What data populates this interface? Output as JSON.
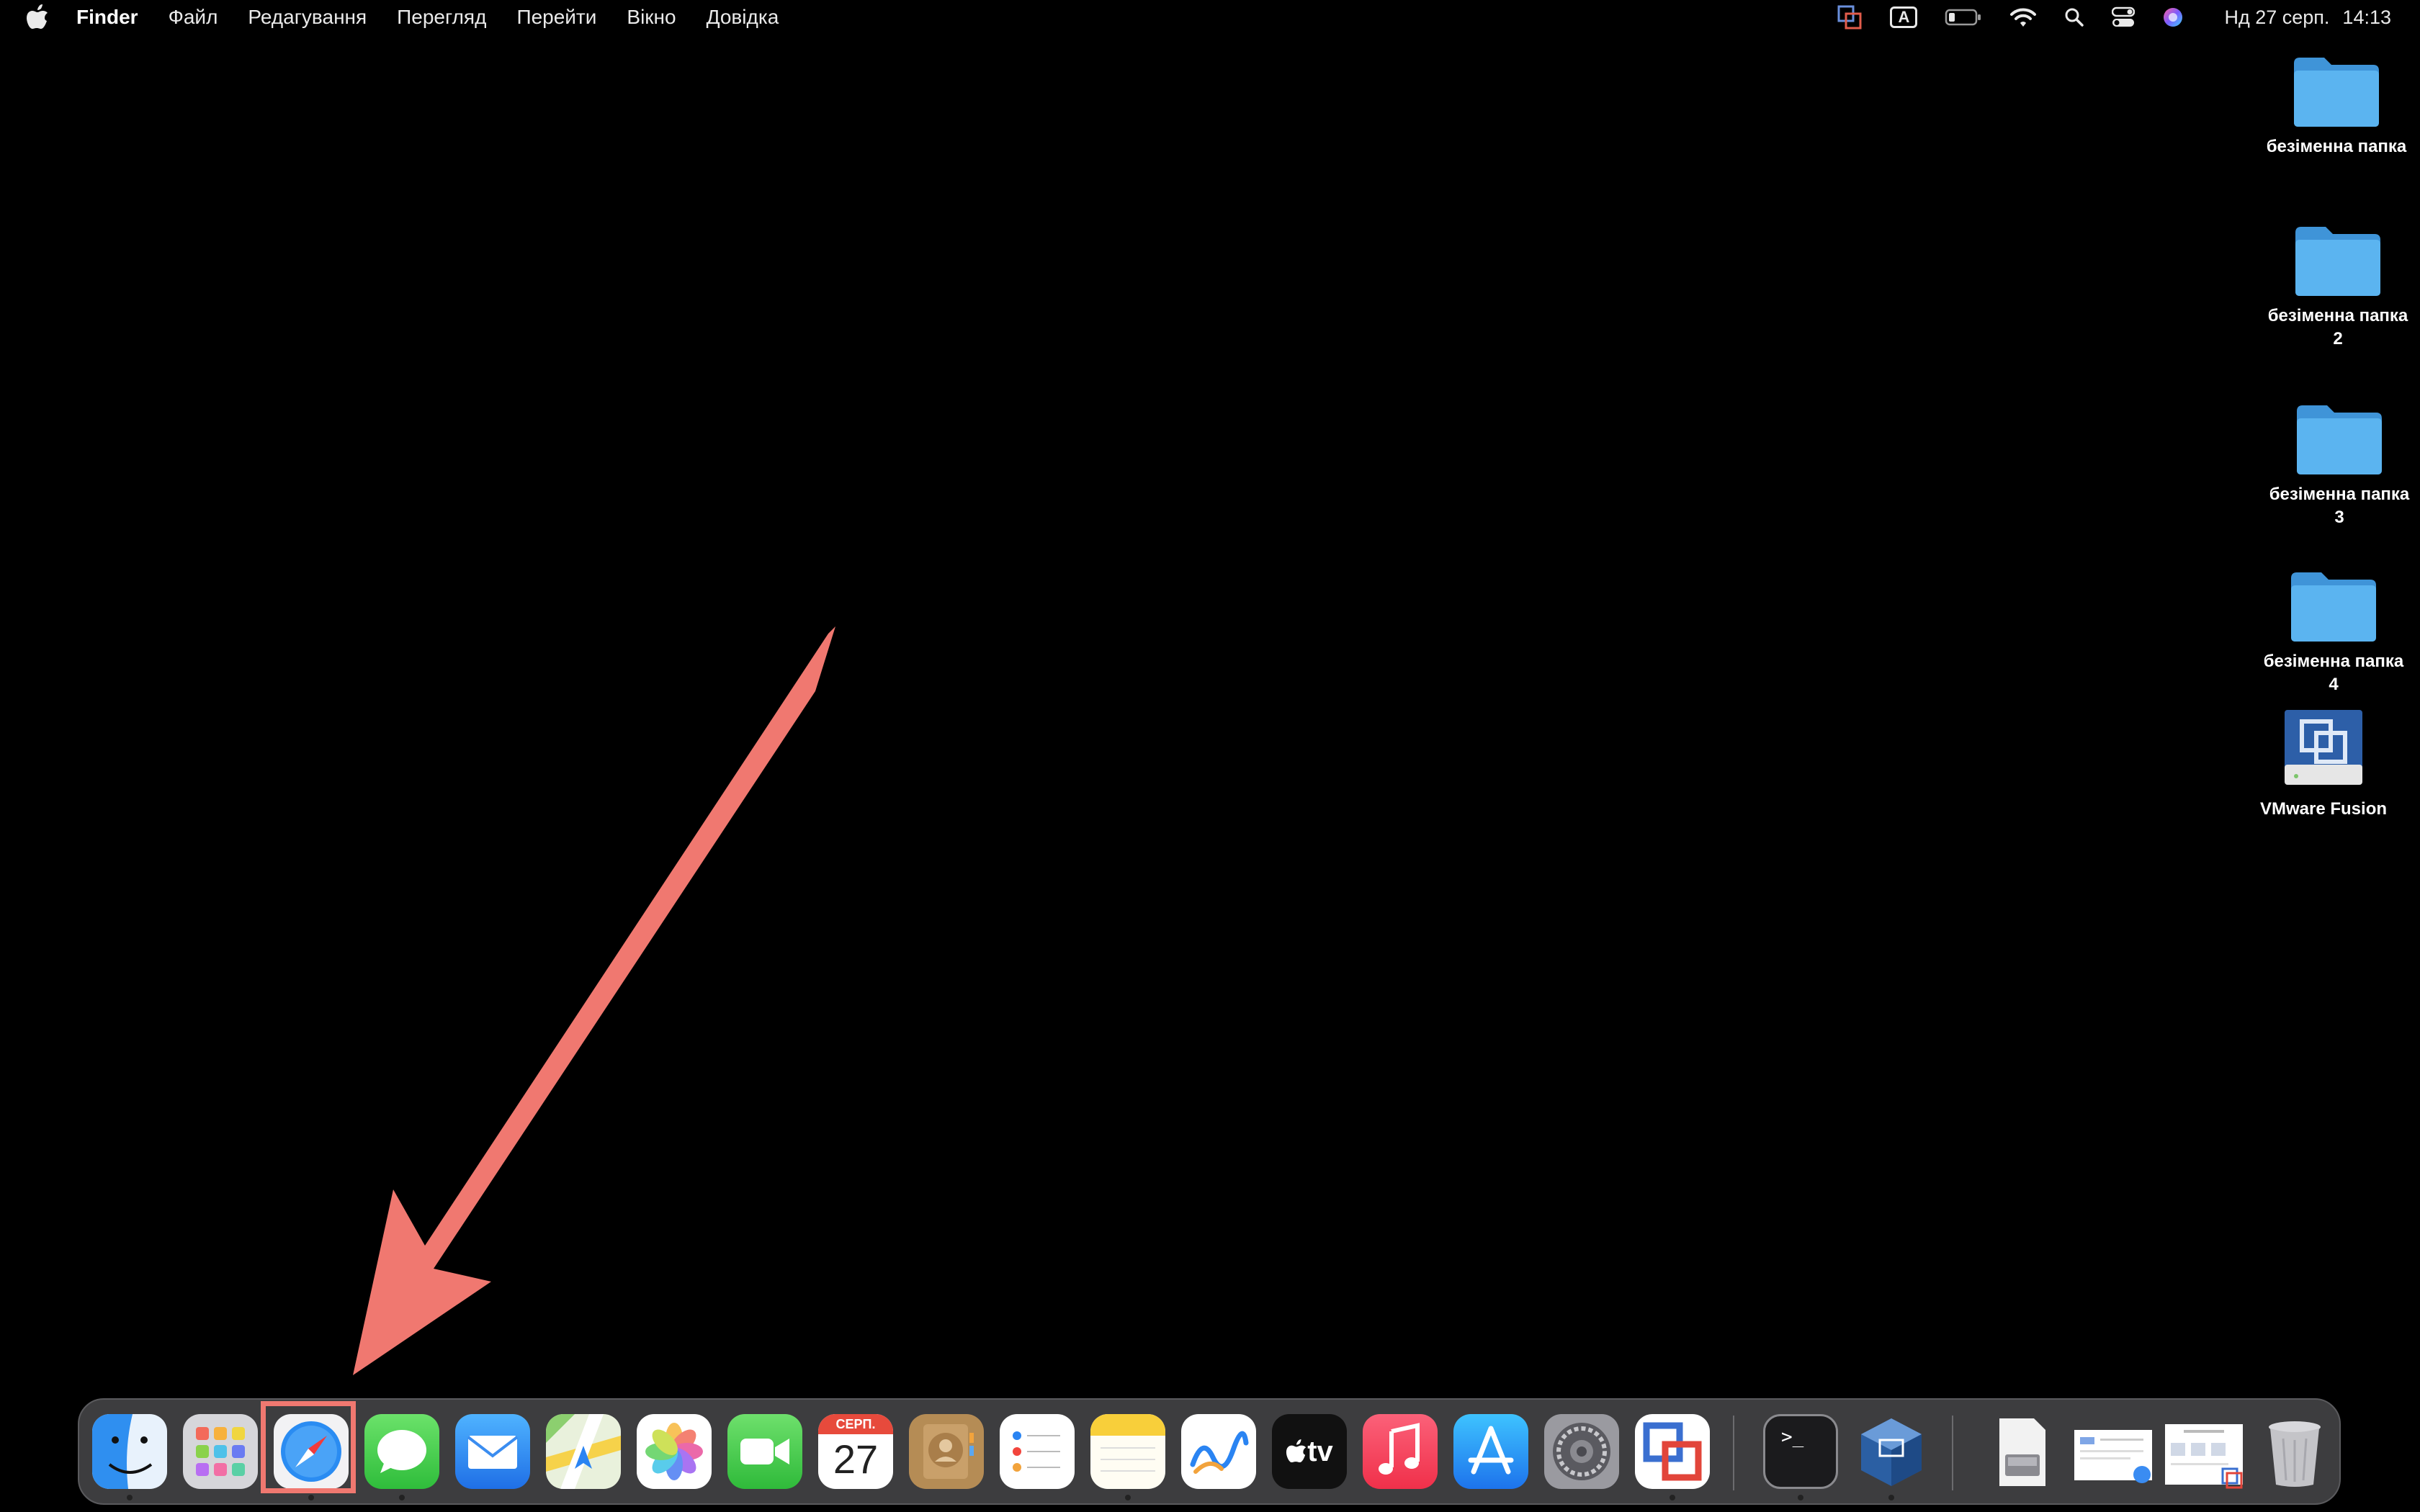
{
  "menubar": {
    "app_name": "Finder",
    "menus": [
      "Файл",
      "Редагування",
      "Перегляд",
      "Перейти",
      "Вікно",
      "Довідка"
    ],
    "input_source": "A",
    "clock_date": "Нд 27 серп.",
    "clock_time": "14:13"
  },
  "desktop": {
    "icons": [
      {
        "label_line1": "безіменна папка",
        "label_line2": ""
      },
      {
        "label_line1": "безіменна папка",
        "label_line2": "2"
      },
      {
        "label_line1": "безіменна папка",
        "label_line2": "3"
      },
      {
        "label_line1": "безіменна папка",
        "label_line2": "4"
      },
      {
        "label_line1": "VMware Fusion",
        "label_line2": ""
      }
    ]
  },
  "dock": {
    "calendar_month": "СЕРП.",
    "calendar_day": "27",
    "tv_label": "tv",
    "terminal_prompt": ">_",
    "apps": [
      "finder-icon",
      "launchpad-icon",
      "safari-icon",
      "messages-icon",
      "mail-icon",
      "maps-icon",
      "photos-icon",
      "facetime-icon",
      "calendar-icon",
      "contacts-icon",
      "reminders-icon",
      "notes-icon",
      "freeform-icon",
      "apple-tv-icon",
      "music-icon",
      "app-store-icon",
      "system-settings-icon",
      "vmware-fusion-icon",
      "terminal-icon",
      "virtualbox-icon",
      "disk-utility-icon",
      "document-stack-icon",
      "screenshot-icon",
      "trash-icon"
    ]
  },
  "colors": {
    "annotation": "#f07870",
    "folder_blue": "#5bb4f0",
    "dock_bg": "#3d3d3f"
  }
}
